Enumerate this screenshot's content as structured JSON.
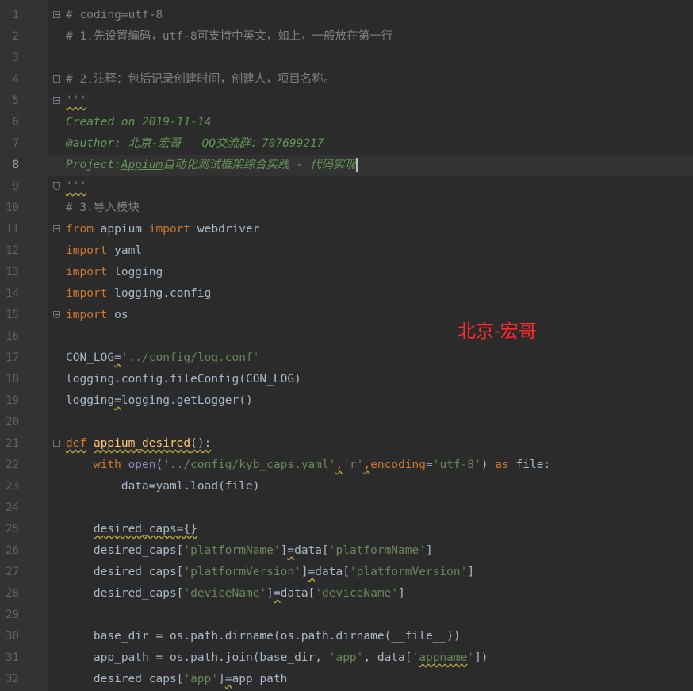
{
  "editor": {
    "theme_colors": {
      "background": "#2b2b2b",
      "gutter": "#313335",
      "line_number": "#606366",
      "comment": "#808080",
      "docstring": "#629755",
      "keyword": "#cc7832",
      "string": "#6a8759",
      "function_name": "#ffc66d",
      "builtin": "#8888c6",
      "identifier": "#a9b7c6"
    },
    "current_line": 8,
    "lines": [
      {
        "n": "1",
        "tokens": [
          {
            "t": "# coding=utf-8",
            "c": "cmt"
          }
        ]
      },
      {
        "n": "2",
        "tokens": [
          {
            "t": "# 1.先设置编码，utf-8可支持中英文，如上，一般放在第一行",
            "c": "cmt"
          }
        ]
      },
      {
        "n": "3",
        "tokens": []
      },
      {
        "n": "4",
        "tokens": [
          {
            "t": "# 2.注释：包括记录创建时间，创建人，项目名称。",
            "c": "cmt"
          }
        ]
      },
      {
        "n": "5",
        "tokens": [
          {
            "t": "'''",
            "c": "doc",
            "s": true
          }
        ]
      },
      {
        "n": "6",
        "tokens": [
          {
            "t": "Created on 2019-11-14",
            "c": "doc"
          }
        ]
      },
      {
        "n": "7",
        "tokens": [
          {
            "t": "@author: 北京-宏哥   QQ交流群：707699217",
            "c": "doc"
          }
        ]
      },
      {
        "n": "8",
        "tokens": [
          {
            "t": "Project:",
            "c": "doc"
          },
          {
            "t": "Appium",
            "c": "doc",
            "u": true
          },
          {
            "t": "自动化测试框架综合实践 - 代码实现",
            "c": "doc"
          }
        ]
      },
      {
        "n": "9",
        "tokens": [
          {
            "t": "'''",
            "c": "doc",
            "s": true
          }
        ]
      },
      {
        "n": "10",
        "tokens": [
          {
            "t": "# 3.导入模块",
            "c": "cmt"
          }
        ]
      },
      {
        "n": "11",
        "tokens": [
          {
            "t": "from",
            "c": "kw"
          },
          {
            "t": " appium ",
            "c": "pl"
          },
          {
            "t": "import",
            "c": "kw"
          },
          {
            "t": " webdriver",
            "c": "pl"
          }
        ]
      },
      {
        "n": "12",
        "tokens": [
          {
            "t": "import",
            "c": "kw"
          },
          {
            "t": " yaml",
            "c": "pl"
          }
        ]
      },
      {
        "n": "13",
        "tokens": [
          {
            "t": "import",
            "c": "kw"
          },
          {
            "t": " logging",
            "c": "pl"
          }
        ]
      },
      {
        "n": "14",
        "tokens": [
          {
            "t": "import",
            "c": "kw"
          },
          {
            "t": " logging.config",
            "c": "pl"
          }
        ]
      },
      {
        "n": "15",
        "tokens": [
          {
            "t": "import",
            "c": "kw"
          },
          {
            "t": " os",
            "c": "pl"
          }
        ]
      },
      {
        "n": "16",
        "tokens": []
      },
      {
        "n": "17",
        "tokens": [
          {
            "t": "CON_LOG",
            "c": "pl"
          },
          {
            "t": "=",
            "c": "pl",
            "s": true
          },
          {
            "t": "'../config/log.conf'",
            "c": "str"
          }
        ]
      },
      {
        "n": "18",
        "tokens": [
          {
            "t": "logging.config.fileConfig(CON_LOG)",
            "c": "pl"
          }
        ]
      },
      {
        "n": "19",
        "tokens": [
          {
            "t": "logging",
            "c": "pl"
          },
          {
            "t": "=",
            "c": "pl",
            "s": true
          },
          {
            "t": "logging.getLogger()",
            "c": "pl"
          }
        ]
      },
      {
        "n": "20",
        "tokens": []
      },
      {
        "n": "21",
        "tokens": [
          {
            "t": "def",
            "c": "kw",
            "s": true
          },
          {
            "t": " ",
            "c": "pl"
          },
          {
            "t": "appium_desired",
            "c": "fn",
            "s": true
          },
          {
            "t": "():",
            "c": "pl",
            "s": true
          }
        ]
      },
      {
        "n": "22",
        "tokens": [
          {
            "t": "    ",
            "c": "pl"
          },
          {
            "t": "with",
            "c": "kw"
          },
          {
            "t": " ",
            "c": "pl"
          },
          {
            "t": "open",
            "c": "bi"
          },
          {
            "t": "(",
            "c": "pl"
          },
          {
            "t": "'../config/kyb_caps.yaml'",
            "c": "str"
          },
          {
            "t": ",",
            "c": "kw",
            "s": true
          },
          {
            "t": "'r'",
            "c": "str"
          },
          {
            "t": ",",
            "c": "kw",
            "s": true
          },
          {
            "t": "encoding",
            "c": "kw"
          },
          {
            "t": "=",
            "c": "pl"
          },
          {
            "t": "'utf-8'",
            "c": "str"
          },
          {
            "t": ") ",
            "c": "pl"
          },
          {
            "t": "as",
            "c": "kw"
          },
          {
            "t": " file:",
            "c": "pl"
          }
        ]
      },
      {
        "n": "23",
        "tokens": [
          {
            "t": "        data",
            "c": "pl"
          },
          {
            "t": "=",
            "c": "pl"
          },
          {
            "t": "yaml.load(file)",
            "c": "pl"
          }
        ]
      },
      {
        "n": "24",
        "tokens": []
      },
      {
        "n": "25",
        "tokens": [
          {
            "t": "    ",
            "c": "pl"
          },
          {
            "t": "desired_caps={}",
            "c": "pl",
            "s": true
          }
        ]
      },
      {
        "n": "26",
        "tokens": [
          {
            "t": "    desired_caps[",
            "c": "pl"
          },
          {
            "t": "'platformName'",
            "c": "str"
          },
          {
            "t": "]",
            "c": "pl"
          },
          {
            "t": "=",
            "c": "pl",
            "s": true
          },
          {
            "t": "data[",
            "c": "pl"
          },
          {
            "t": "'platformName'",
            "c": "str"
          },
          {
            "t": "]",
            "c": "pl"
          }
        ]
      },
      {
        "n": "27",
        "tokens": [
          {
            "t": "    desired_caps[",
            "c": "pl"
          },
          {
            "t": "'platformVersion'",
            "c": "str"
          },
          {
            "t": "]",
            "c": "pl"
          },
          {
            "t": "=",
            "c": "pl",
            "s": true
          },
          {
            "t": "data[",
            "c": "pl"
          },
          {
            "t": "'platformVersion'",
            "c": "str"
          },
          {
            "t": "]",
            "c": "pl"
          }
        ]
      },
      {
        "n": "28",
        "tokens": [
          {
            "t": "    desired_caps[",
            "c": "pl"
          },
          {
            "t": "'deviceName'",
            "c": "str"
          },
          {
            "t": "]",
            "c": "pl"
          },
          {
            "t": "=",
            "c": "pl",
            "s": true
          },
          {
            "t": "data[",
            "c": "pl"
          },
          {
            "t": "'deviceName'",
            "c": "str"
          },
          {
            "t": "]",
            "c": "pl"
          }
        ]
      },
      {
        "n": "29",
        "tokens": []
      },
      {
        "n": "30",
        "tokens": [
          {
            "t": "    base_dir = os.path.dirname(os.path.dirname(__file__))",
            "c": "pl"
          }
        ]
      },
      {
        "n": "31",
        "tokens": [
          {
            "t": "    app_path = os.path.join(base_dir, ",
            "c": "pl"
          },
          {
            "t": "'app'",
            "c": "str"
          },
          {
            "t": ", data[",
            "c": "pl"
          },
          {
            "t": "'",
            "c": "str"
          },
          {
            "t": "appname",
            "c": "str",
            "s": true
          },
          {
            "t": "'",
            "c": "str"
          },
          {
            "t": "])",
            "c": "pl"
          }
        ]
      },
      {
        "n": "32",
        "tokens": [
          {
            "t": "    desired_caps[",
            "c": "pl"
          },
          {
            "t": "'app'",
            "c": "str"
          },
          {
            "t": "]",
            "c": "pl"
          },
          {
            "t": "=",
            "c": "pl",
            "s": true
          },
          {
            "t": "app_path",
            "c": "pl"
          }
        ]
      }
    ]
  },
  "watermark": {
    "text": "北京-宏哥",
    "color": "#ff2a2a"
  }
}
